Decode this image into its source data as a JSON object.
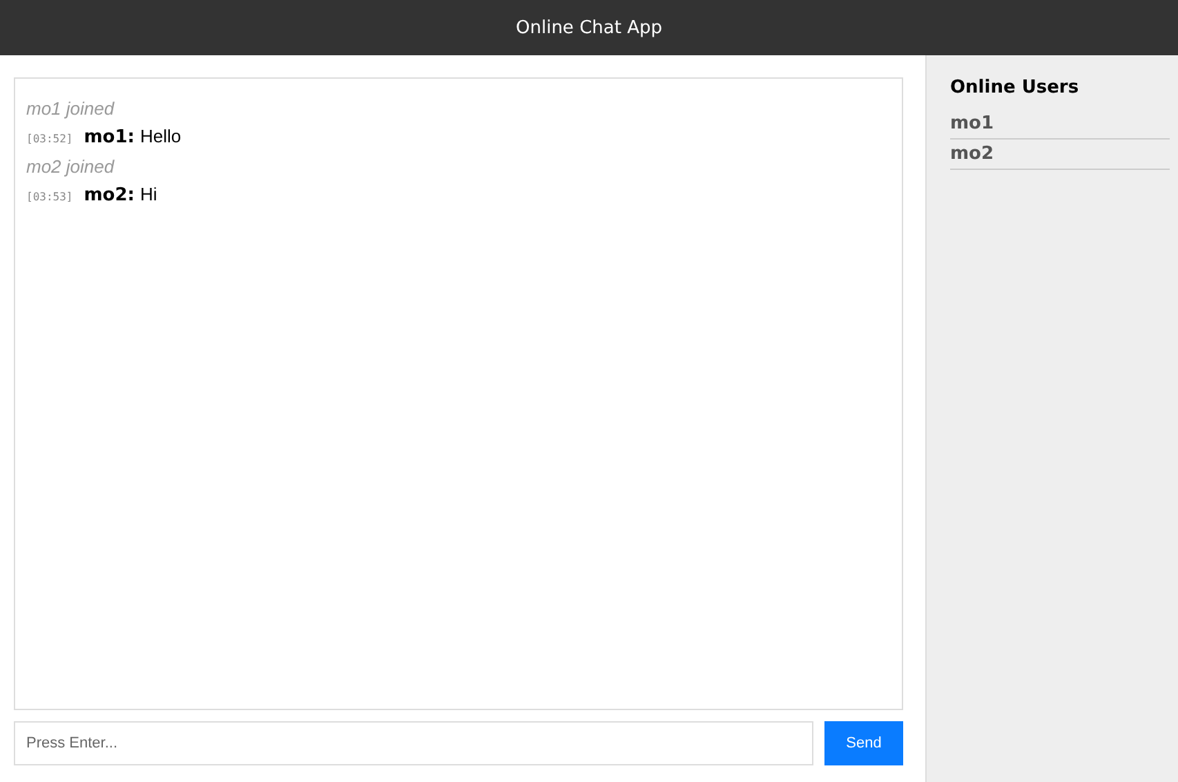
{
  "header": {
    "title": "Online Chat App"
  },
  "messages": [
    {
      "kind": "join",
      "text": "mo1 joined"
    },
    {
      "kind": "message",
      "time": "[03:52]",
      "user": "mo1:",
      "text": "Hello"
    },
    {
      "kind": "join",
      "text": "mo2 joined"
    },
    {
      "kind": "message",
      "time": "[03:53]",
      "user": "mo2:",
      "text": "Hi"
    }
  ],
  "input": {
    "placeholder": "Press Enter..."
  },
  "send_button": "Send",
  "sidebar": {
    "title": "Online Users",
    "users": [
      "mo1",
      "mo2"
    ]
  }
}
